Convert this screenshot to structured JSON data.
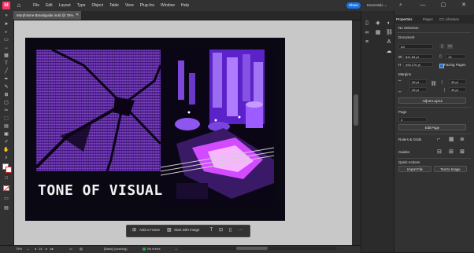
{
  "menubar": {
    "logo": "Id",
    "menus": [
      "File",
      "Edit",
      "Layout",
      "Type",
      "Object",
      "Table",
      "View",
      "Plug-Ins",
      "Window",
      "Help"
    ],
    "share_label": "Share",
    "workspace": "Essentials ⌄",
    "window_controls": [
      "—",
      "▢",
      "✕"
    ]
  },
  "document": {
    "tab_title": "Morphisme Brandguide.indd @ 75%",
    "tab_close": "✕",
    "headline": "TONE OF VISUAL",
    "page_color": "#0a0812",
    "accent_purple": "#7b45c4"
  },
  "taskbar": {
    "add_frame": "Add a Frame",
    "start_image": "Start with Image",
    "more": "···"
  },
  "statusbar": {
    "zoom": "75%",
    "page": "14",
    "style": "[Basic] (working)",
    "preflight": "No errors"
  },
  "panel": {
    "tabs": [
      "Properties",
      "Pages",
      "CC Libraries"
    ],
    "selection": "No Selection",
    "document_label": "Document",
    "preset": "A4",
    "width": "841.89 pt",
    "height": "595.276 pt",
    "pages_value": "13",
    "facing_pages": "Facing Pages",
    "margins_label": "Margins",
    "margin_top": "36 pt",
    "margin_left": "36 pt",
    "margin_bottom": "36 pt",
    "margin_right": "36 pt",
    "adjust_layout": "Adjust Layout",
    "page_label": "Page",
    "page_value": "4",
    "edit_page": "Edit Page",
    "rulers_label": "Rulers & Grids",
    "guides_label": "Guides",
    "quick_actions_label": "Quick Actions",
    "import_file": "Import File",
    "text_to_image": "Text to Image"
  }
}
